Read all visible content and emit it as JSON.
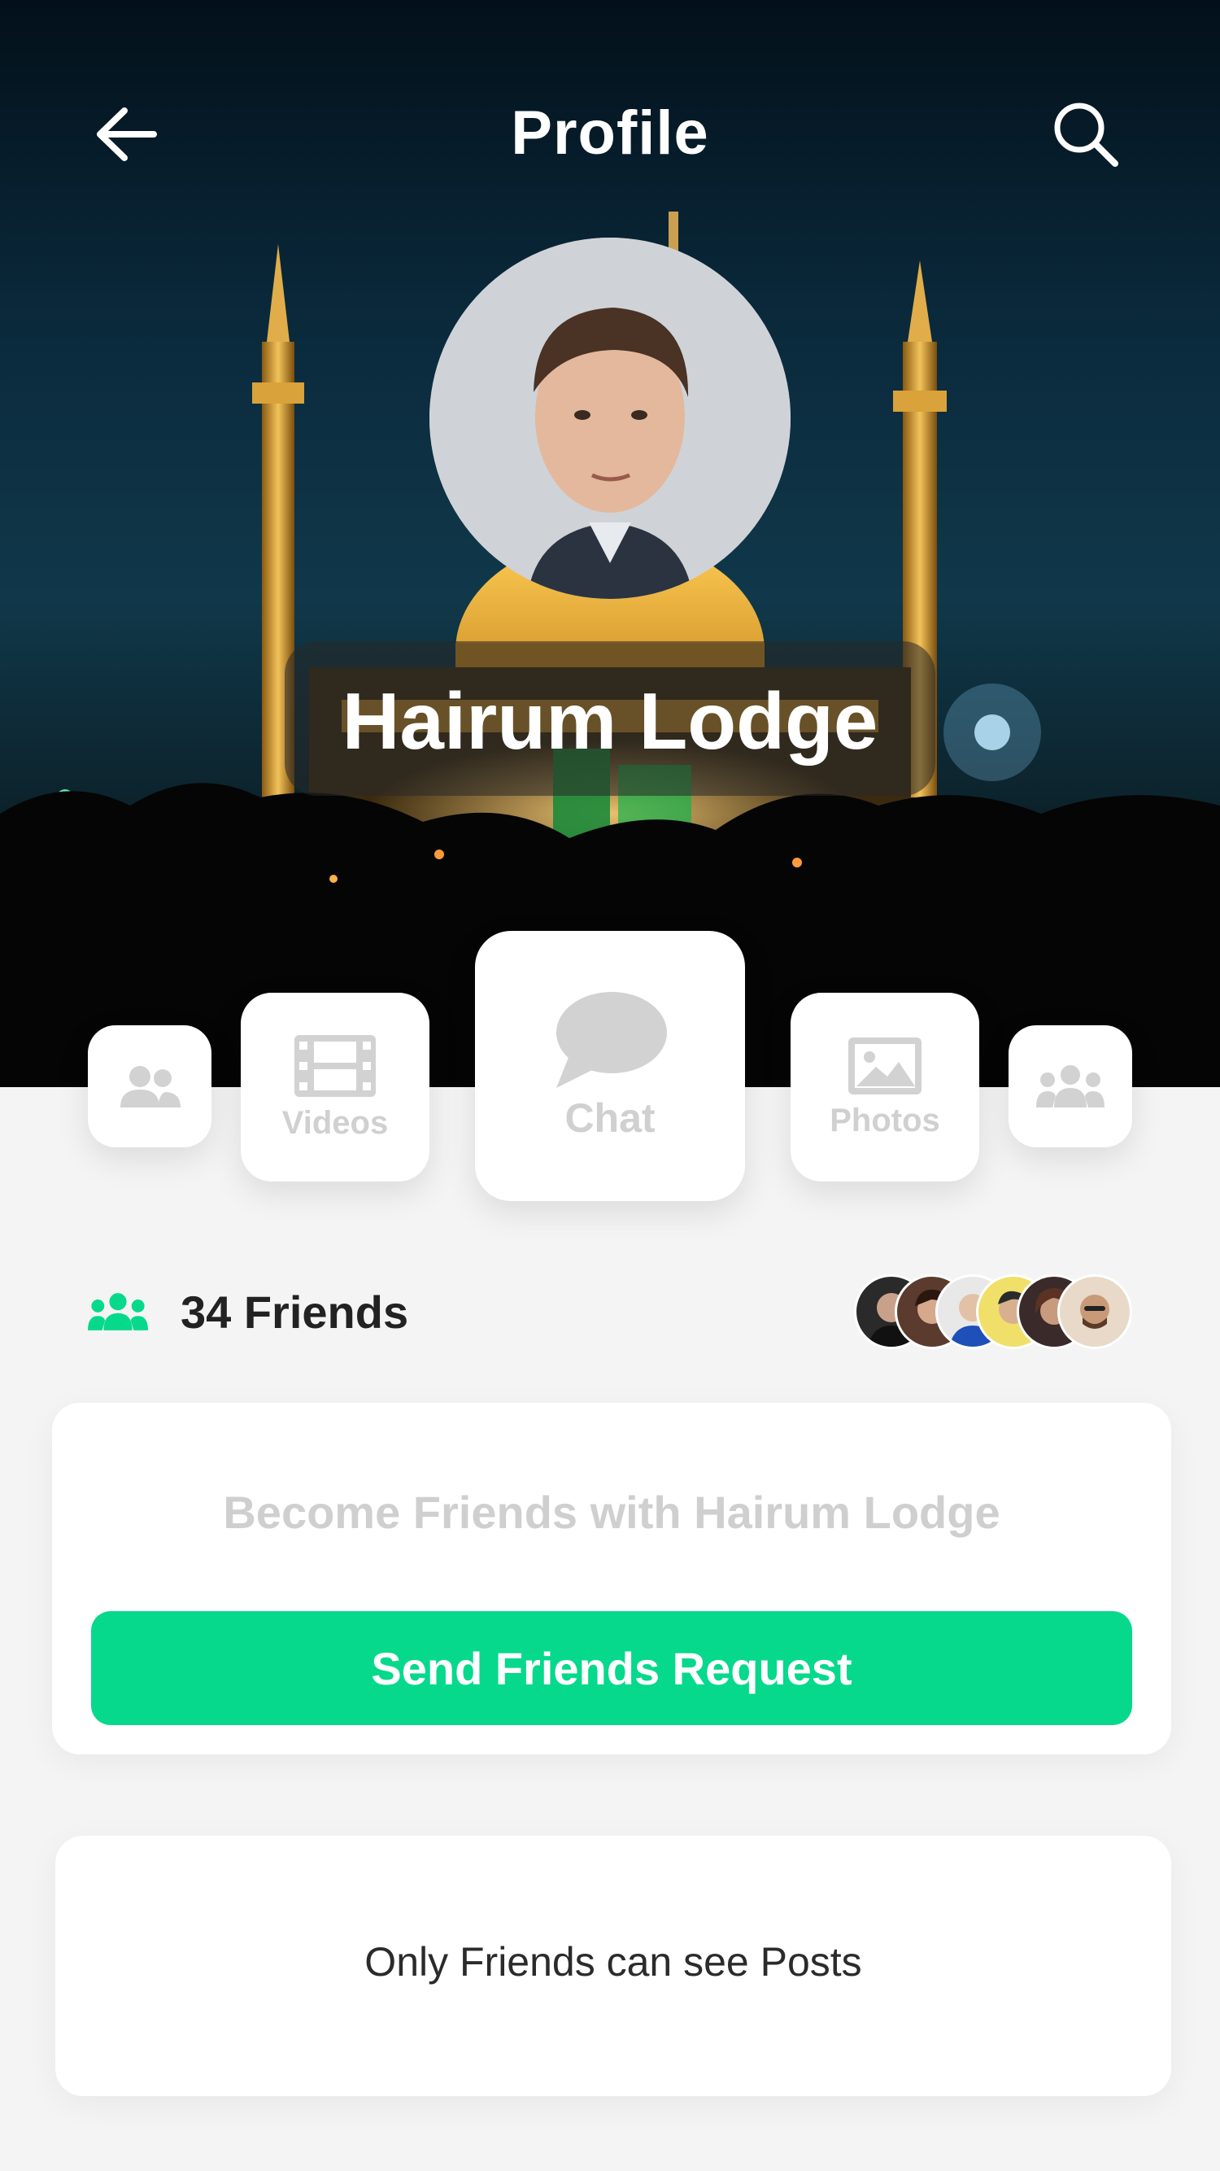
{
  "header": {
    "title": "Profile"
  },
  "profile": {
    "name": "Hairum Lodge"
  },
  "tabs": [
    {
      "label": "",
      "icon": "users-icon"
    },
    {
      "label": "Videos",
      "icon": "film-icon"
    },
    {
      "label": "Chat",
      "icon": "chat-bubble-icon"
    },
    {
      "label": "Photos",
      "icon": "image-icon"
    },
    {
      "label": "",
      "icon": "group-icon"
    }
  ],
  "friends": {
    "count_label": "34 Friends",
    "icon": "friends-icon",
    "avatar_count": 6
  },
  "friend_card": {
    "prompt": "Become Friends with Hairum Lodge",
    "button_label": "Send Friends Request"
  },
  "posts_card": {
    "message": "Only Friends can see Posts"
  },
  "colors": {
    "accent": "#06d98b",
    "background": "#f4f4f4",
    "tile_icon": "#d2d2d2"
  }
}
